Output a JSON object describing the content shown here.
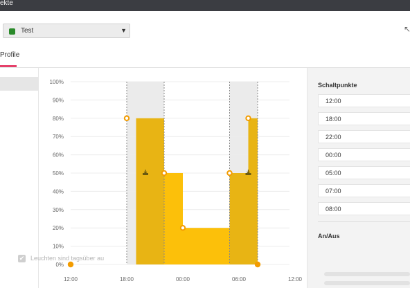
{
  "window": {
    "title": "ekte"
  },
  "profile": {
    "selected": "Test",
    "status_color": "#2a8a2a"
  },
  "tabs": [
    {
      "label": "Profile",
      "active": true
    }
  ],
  "chart_data": {
    "type": "area",
    "y_ticks": [
      "100%",
      "90%",
      "80%",
      "70%",
      "60%",
      "50%",
      "40%",
      "30%",
      "20%",
      "10%",
      "0%"
    ],
    "x_ticks": [
      "12:00",
      "18:00",
      "00:00",
      "06:00",
      "12:00"
    ],
    "ylim": [
      0,
      100
    ],
    "shaded_ranges": [
      [
        "18:00",
        "22:00"
      ],
      [
        "05:00",
        "08:00"
      ]
    ],
    "segments": [
      {
        "start": "19:00",
        "end": "22:00",
        "value": 80,
        "shade": "dark"
      },
      {
        "start": "22:00",
        "end": "00:00",
        "value": 50,
        "shade": "light"
      },
      {
        "start": "00:00",
        "end": "05:00",
        "value": 20,
        "shade": "light"
      },
      {
        "start": "05:00",
        "end": "07:00",
        "value": 50,
        "shade": "dark"
      },
      {
        "start": "07:00",
        "end": "08:00",
        "value": 80,
        "shade": "dark"
      }
    ],
    "points": [
      {
        "time": "12:00",
        "value": 0
      },
      {
        "time": "18:00",
        "value": 80
      },
      {
        "time": "22:00",
        "value": 50
      },
      {
        "time": "00:00",
        "value": 20
      },
      {
        "time": "05:00",
        "value": 50
      },
      {
        "time": "07:00",
        "value": 80
      },
      {
        "time": "08:00",
        "value": 0
      }
    ],
    "markers": [
      {
        "time": "20:00",
        "value": 50,
        "icon": "sun-set-icon"
      },
      {
        "time": "07:00",
        "value": 50,
        "icon": "sun-rise-icon"
      }
    ],
    "colors": {
      "dark": "#e8b414",
      "light": "#fcc00a",
      "point": "#f39c00",
      "shade": "#ebebeb"
    }
  },
  "right_panel": {
    "schaltpunkte_title": "Schaltpunkte",
    "schaltpunkte": [
      "12:00",
      "18:00",
      "22:00",
      "00:00",
      "05:00",
      "07:00",
      "08:00"
    ],
    "anaus_title": "An/Aus",
    "checkbox_label": "Leuchten sind tagsüber au"
  }
}
